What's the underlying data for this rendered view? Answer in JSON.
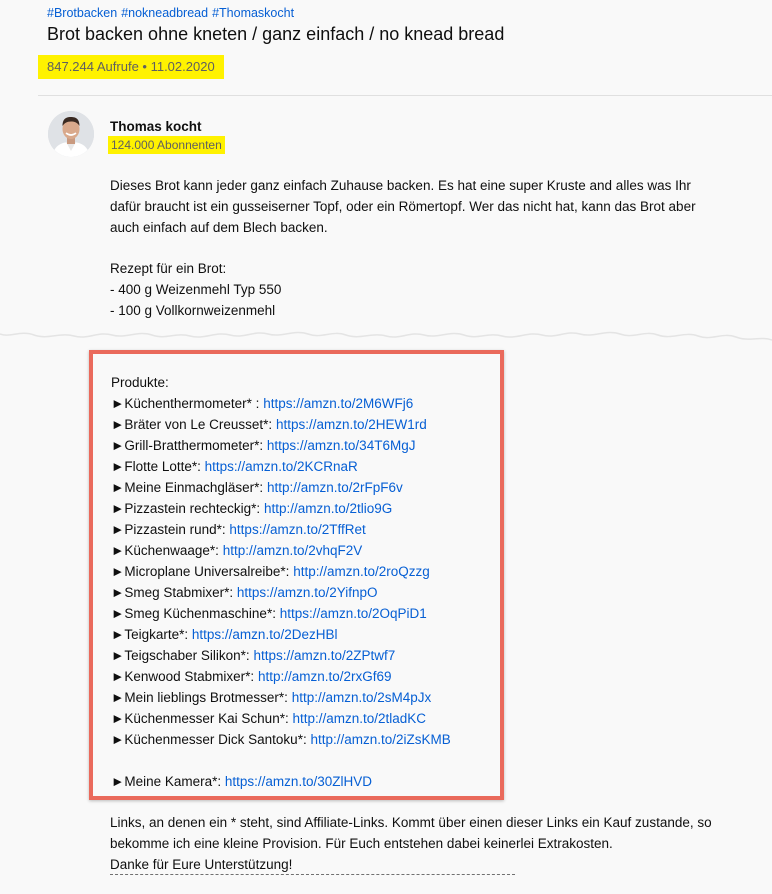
{
  "video": {
    "hashtags": [
      "#Brotbacken",
      "#nokneadbread",
      "#Thomaskocht"
    ],
    "title": "Brot backen ohne kneten / ganz einfach / no knead bread",
    "views_date": "847.244 Aufrufe • 11.02.2020"
  },
  "channel": {
    "name": "Thomas kocht",
    "subscribers": "124.000 Abonnenten"
  },
  "description": {
    "intro": "Dieses Brot kann jeder ganz einfach Zuhause backen. Es hat eine super Kruste and alles was Ihr dafür braucht ist ein gusseiserner Topf, oder ein Römertopf. Wer das nicht hat, kann das Brot aber auch einfach auf dem Blech backen.",
    "recipe_heading": "Rezept für ein Brot:",
    "recipe_items": [
      "- 400 g Weizenmehl Typ 550",
      "- 100 g Vollkornweizenmehl"
    ]
  },
  "products": {
    "heading": "Produkte:",
    "items": [
      {
        "label": "►Küchenthermometer* : ",
        "url": "https://amzn.to/2M6WFj6"
      },
      {
        "label": "►Bräter von Le Creusset*: ",
        "url": "https://amzn.to/2HEW1rd"
      },
      {
        "label": "►Grill-Bratthermometer*: ",
        "url": "https://amzn.to/34T6MgJ"
      },
      {
        "label": "►Flotte Lotte*: ",
        "url": "https://amzn.to/2KCRnaR"
      },
      {
        "label": "►Meine Einmachgläser*: ",
        "url": "http://amzn.to/2rFpF6v"
      },
      {
        "label": "►Pizzastein rechteckig*: ",
        "url": "http://amzn.to/2tlio9G"
      },
      {
        "label": "►Pizzastein rund*: ",
        "url": "https://amzn.to/2TffRet"
      },
      {
        "label": "►Küchenwaage*: ",
        "url": "http://amzn.to/2vhqF2V"
      },
      {
        "label": "►Microplane Universalreibe*: ",
        "url": "http://amzn.to/2roQzzg"
      },
      {
        "label": "►Smeg Stabmixer*: ",
        "url": "https://amzn.to/2YifnpO"
      },
      {
        "label": "►Smeg Küchenmaschine*: ",
        "url": "https://amzn.to/2OqPiD1"
      },
      {
        "label": "►Teigkarte*: ",
        "url": "https://amzn.to/2DezHBl"
      },
      {
        "label": "►Teigschaber Silikon*: ",
        "url": "https://amzn.to/2ZPtwf7"
      },
      {
        "label": "►Kenwood Stabmixer*: ",
        "url": "http://amzn.to/2rxGf69"
      },
      {
        "label": "►Mein lieblings Brotmesser*: ",
        "url": "http://amzn.to/2sM4pJx"
      },
      {
        "label": "►Küchenmesser Kai Schun*: ",
        "url": "http://amzn.to/2tladKC"
      },
      {
        "label": "►Küchenmesser Dick Santoku*: ",
        "url": "http://amzn.to/2iZsKMB"
      }
    ],
    "camera": {
      "label": "►Meine Kamera*: ",
      "url": "https://amzn.to/30ZlHVD"
    }
  },
  "affiliate": {
    "text": "Links, an denen ein * steht, sind Affiliate-Links. Kommt über einen dieser Links ein Kauf zustande, so bekomme ich eine kleine Provision. Für Euch entstehen dabei keinerlei Extrakosten.",
    "thanks": "Danke für Eure Unterstützung!"
  },
  "colors": {
    "link": "#065fd4",
    "highlight": "#fff200",
    "box_border": "#ea6a5c",
    "meta_text": "#606060"
  }
}
